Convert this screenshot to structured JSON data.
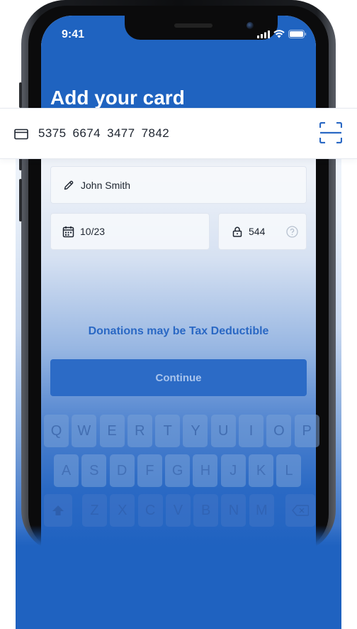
{
  "status_bar": {
    "time": "9:41"
  },
  "screen": {
    "title": "Add your card"
  },
  "card": {
    "number": "5375  6674  3477  7842"
  },
  "form": {
    "name_value": "John Smith",
    "expiry_value": "10/23",
    "cvv_value": "544"
  },
  "tax_note": "Donations may be Tax Deductible",
  "continue_label": "Continue",
  "keyboard": {
    "row1": [
      "Q",
      "W",
      "E",
      "R",
      "T",
      "Y",
      "U",
      "I",
      "O",
      "P"
    ],
    "row2": [
      "A",
      "S",
      "D",
      "F",
      "G",
      "H",
      "J",
      "K",
      "L"
    ],
    "row3": [
      "Z",
      "X",
      "C",
      "V",
      "B",
      "N",
      "M"
    ]
  },
  "colors": {
    "brand_blue": "#1f63c0",
    "accent_text": "#2a68c4",
    "button_bg": "#2c6bc6",
    "button_text": "#a9c4ec"
  }
}
